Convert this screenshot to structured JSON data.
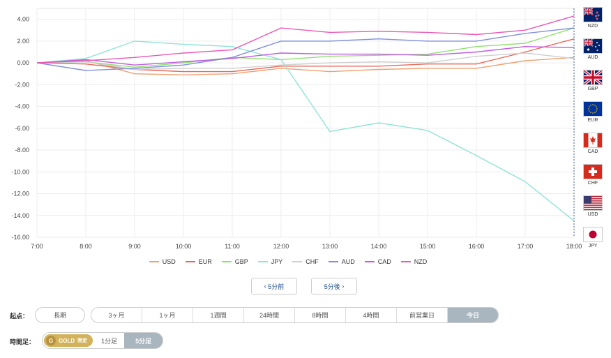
{
  "chart_data": {
    "type": "line",
    "x": [
      "7:00",
      "8:00",
      "9:00",
      "10:00",
      "11:00",
      "12:00",
      "13:00",
      "14:00",
      "15:00",
      "16:00",
      "17:00",
      "18:00"
    ],
    "ylim": [
      -16,
      5
    ],
    "yticks": [
      "4.00",
      "2.00",
      "0.00",
      "-2.00",
      "-4.00",
      "-6.00",
      "-8.00",
      "-10.00",
      "-12.00",
      "-14.00",
      "-16.00"
    ],
    "grid": true,
    "legend_position": "bottom",
    "series": [
      {
        "name": "USD",
        "color": "#f0a070",
        "values": [
          0,
          0.2,
          -1.0,
          -1.1,
          -1.0,
          -0.5,
          -0.8,
          -0.6,
          -0.5,
          -0.5,
          0.2,
          0.5
        ]
      },
      {
        "name": "EUR",
        "color": "#e8695a",
        "values": [
          0,
          -0.1,
          -0.6,
          -0.8,
          -0.8,
          -0.3,
          -0.3,
          -0.3,
          -0.1,
          -0.1,
          1.0,
          2.2
        ]
      },
      {
        "name": "GBP",
        "color": "#90e070",
        "values": [
          0,
          0.1,
          -0.4,
          0,
          0.5,
          0.3,
          0.6,
          0.7,
          0.8,
          1.5,
          1.8,
          3.2
        ]
      },
      {
        "name": "JPY",
        "color": "#8fe3d8",
        "values": [
          0,
          0.4,
          2.0,
          1.7,
          1.5,
          0.3,
          -6.3,
          -5.5,
          -6.2,
          -8.5,
          -10.9,
          -14.5
        ]
      },
      {
        "name": "CHF",
        "color": "#cfcfcf",
        "values": [
          0,
          0.1,
          -0.6,
          -0.5,
          -0.5,
          -0.2,
          0,
          0.1,
          0,
          0.6,
          0.9,
          0.4
        ]
      },
      {
        "name": "AUD",
        "color": "#7f8fdc",
        "values": [
          0,
          -0.7,
          -0.5,
          -0.2,
          0.5,
          2.0,
          2.0,
          2.2,
          2.0,
          2.0,
          2.7,
          3.2
        ]
      },
      {
        "name": "CAD",
        "color": "#c05ce0",
        "values": [
          0,
          0.3,
          -0.2,
          0.1,
          0.4,
          0.9,
          0.8,
          0.8,
          0.7,
          1.0,
          1.5,
          1.4
        ]
      },
      {
        "name": "NZD",
        "color": "#e85ab5",
        "values": [
          0,
          0.2,
          0.5,
          0.9,
          1.2,
          3.2,
          2.8,
          2.9,
          2.8,
          2.6,
          3.0,
          4.3
        ]
      }
    ]
  },
  "flags": [
    {
      "label": "NZD",
      "icon": "nz-flag-icon"
    },
    {
      "label": "AUD",
      "icon": "au-flag-icon"
    },
    {
      "label": "GBP",
      "icon": "uk-flag-icon"
    },
    {
      "label": "EUR",
      "icon": "eu-flag-icon"
    },
    {
      "label": "CAD",
      "icon": "ca-flag-icon"
    },
    {
      "label": "CHF",
      "icon": "ch-flag-icon"
    },
    {
      "label": "USD",
      "icon": "us-flag-icon"
    },
    {
      "label": "JPY",
      "icon": "jp-flag-icon"
    }
  ],
  "nav": {
    "prev_label": "5分前",
    "next_label": "5分後"
  },
  "start_point": {
    "label": "起点：",
    "long_term": "長期",
    "options": [
      "3ヶ月",
      "1ヶ月",
      "1週間",
      "24時間",
      "8時間",
      "4時間",
      "前営業日",
      "今日"
    ],
    "selected": "今日"
  },
  "timeframe": {
    "label": "時間足：",
    "gold_text": "GOLD",
    "gold_limit": "限定",
    "options": [
      "1分足",
      "5分足"
    ],
    "selected": "5分足"
  },
  "colors": {
    "accent": "#a9b5bf",
    "gold": "#d2b25a",
    "link": "#1a4b8c",
    "cursor_line": "#3b5ca8"
  }
}
